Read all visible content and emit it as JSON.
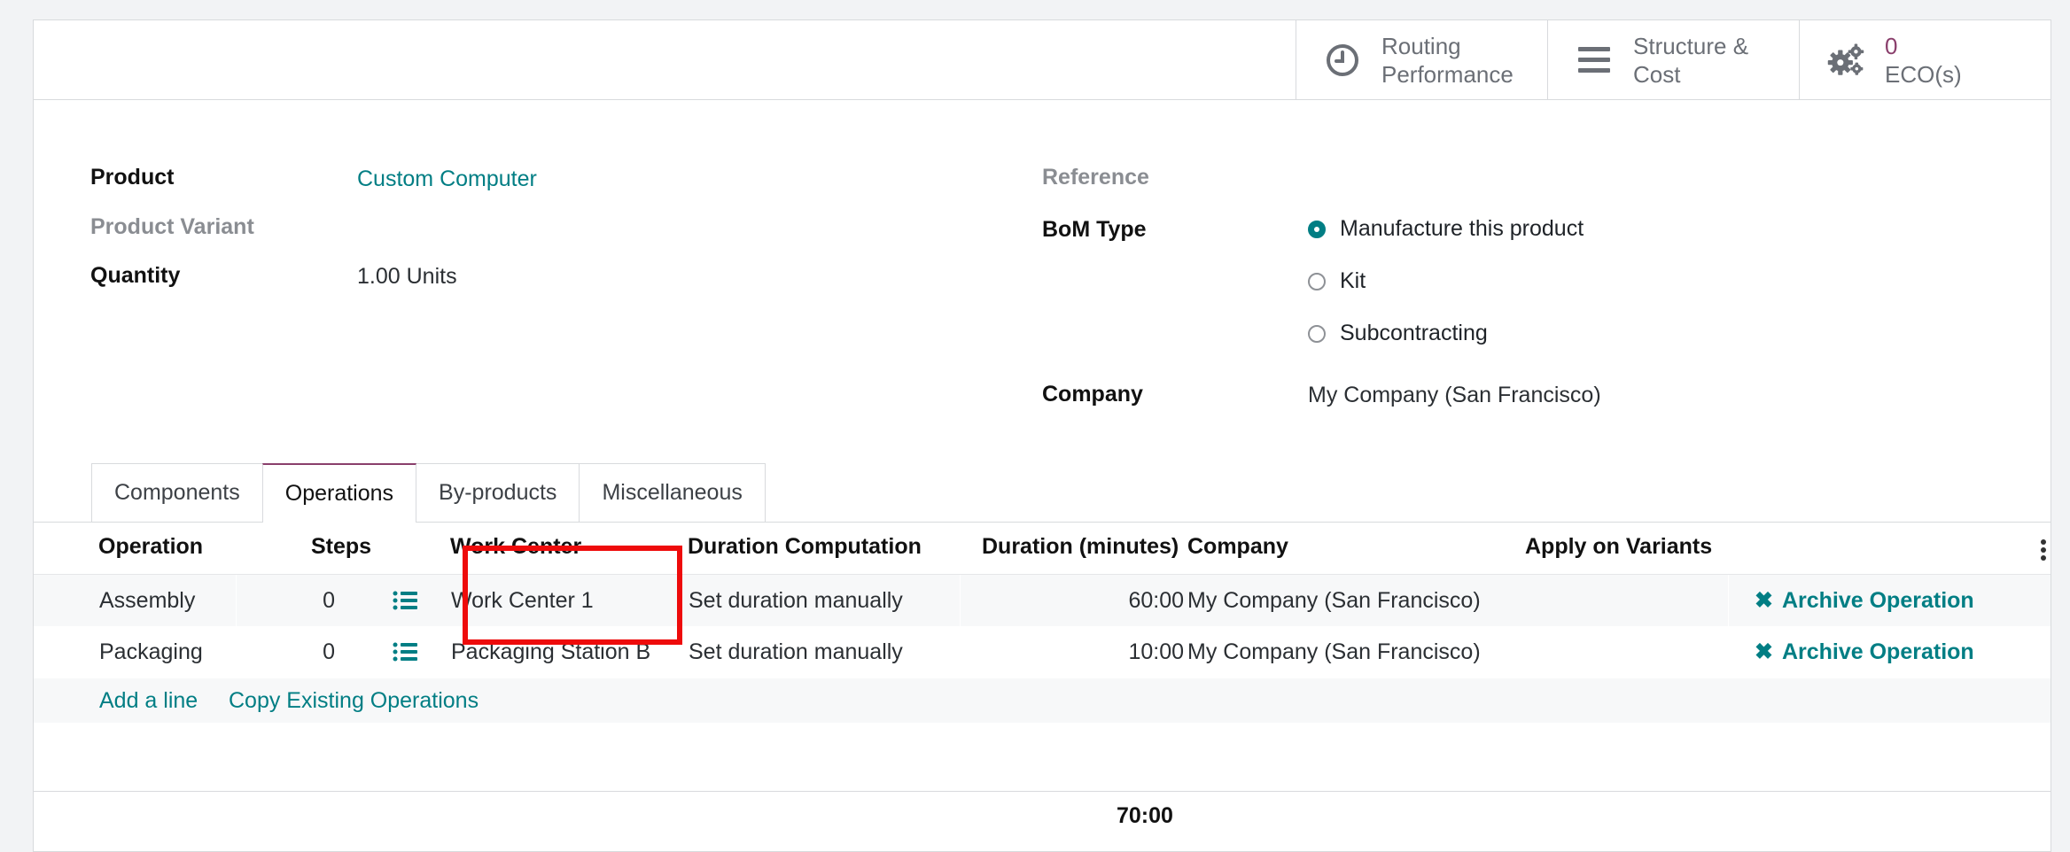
{
  "smart_buttons": {
    "routing": {
      "line1": "Routing",
      "line2": "Performance",
      "icon": "clock-icon"
    },
    "structure": {
      "line1": "Structure &",
      "line2": "Cost",
      "icon": "bars-icon"
    },
    "eco": {
      "count": "0",
      "label": "ECO(s)",
      "icon": "gears-icon"
    }
  },
  "form": {
    "product_label": "Product",
    "product_value": "Custom Computer",
    "variant_label": "Product Variant",
    "quantity_label": "Quantity",
    "quantity_value": "1.00",
    "quantity_uom": "Units",
    "reference_label": "Reference",
    "bom_type_label": "BoM Type",
    "bom_type_options": [
      "Manufacture this product",
      "Kit",
      "Subcontracting"
    ],
    "bom_type_selected": "Manufacture this product",
    "company_label": "Company",
    "company_value": "My Company (San Francisco)"
  },
  "tabs": [
    "Components",
    "Operations",
    "By-products",
    "Miscellaneous"
  ],
  "active_tab": "Operations",
  "table": {
    "headers": {
      "operation": "Operation",
      "steps": "Steps",
      "work_center": "Work Center",
      "duration_computation": "Duration Computation",
      "duration": "Duration (minutes)",
      "company": "Company",
      "apply_on_variants": "Apply on Variants"
    },
    "rows": [
      {
        "operation": "Assembly",
        "steps": "0",
        "work_center": "Work Center 1",
        "duration_computation": "Set duration manually",
        "duration": "60:00",
        "company": "My Company (San Francisco)",
        "action": "Archive Operation"
      },
      {
        "operation": "Packaging",
        "steps": "0",
        "work_center": "Packaging Station B",
        "duration_computation": "Set duration manually",
        "duration": "10:00",
        "company": "My Company (San Francisco)",
        "action": "Archive Operation"
      }
    ],
    "add_line": "Add a line",
    "copy_existing": "Copy Existing Operations",
    "total_duration": "70:00"
  },
  "colors": {
    "accent": "#017e84",
    "brand": "#8a3f6c",
    "highlight": "#ee0b0b"
  }
}
